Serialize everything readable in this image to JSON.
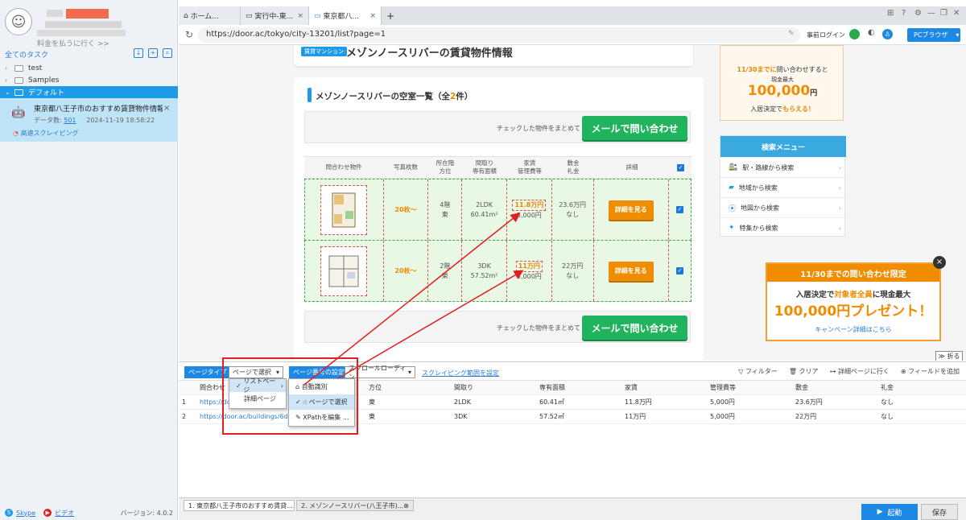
{
  "sidebar": {
    "pay_link": "料金を払うに行く >>",
    "all_tasks": "全てのタスク",
    "tree": [
      {
        "label": "test"
      },
      {
        "label": "Samples"
      },
      {
        "label": "デフォルト"
      }
    ],
    "task": {
      "title": "東京都八王子市のおすすめ賃貸物件情報【...",
      "data_label": "データ数:",
      "data_count": "501",
      "date": "2024-11-19 18:58:22",
      "speed": "高速スクレイピング"
    },
    "footer": {
      "skype": "Skype",
      "video": "ビデオ",
      "version": "バージョン: 4.0.2"
    }
  },
  "browser": {
    "tabs": [
      "ホーム...",
      "実行中-東...",
      "東京都八..."
    ],
    "new_tab": "+",
    "url": "https://door.ac/tokyo/city-13201/list?page=1",
    "login": "事前ログイン",
    "pc_browser": "PCブラウザ"
  },
  "page": {
    "badge": "賃貸マンション",
    "title": "メゾンノースリバーの賃貸物件情報",
    "section_title_prefix": "メゾンノースリバーの空室一覧（全",
    "section_count": "2",
    "section_title_suffix": "件）",
    "mail_note": "チェックした物件をまとめて",
    "mail_button": "メールで問い合わせ",
    "headers": [
      "問合わせ物件",
      "写真枚数",
      "所在階\n方位",
      "間取り\n専有面積",
      "家賃\n管理費等",
      "敷金\n礼金",
      "詳細"
    ],
    "rows": [
      {
        "photos": "20枚～",
        "floor": "4階",
        "dir": "東",
        "layout": "2LDK",
        "area": "60.41m²",
        "rent": "11.8万円",
        "fee": "5,000円",
        "deposit": "23.6万円",
        "key": "なし",
        "detail": "詳細を見る"
      },
      {
        "photos": "20枚～",
        "floor": "2階",
        "dir": "東",
        "layout": "3DK",
        "area": "57.52m²",
        "rent": "11万円",
        "fee": "5,000円",
        "deposit": "22万円",
        "key": "なし",
        "detail": "詳細を見る"
      }
    ],
    "promo_top": {
      "l1a": "11/30までに",
      "l1b": "問い合わせすると",
      "l2": "現金最大",
      "l3": "100,000",
      "l3u": "円",
      "l4a": "入居決定で",
      "l4b": "もらえる！"
    },
    "search_menu": {
      "title": "検索メニュー",
      "items": [
        "駅・路線から検索",
        "地域から検索",
        "地図から検索",
        "特集から検索"
      ]
    },
    "promo": {
      "head": "11/30までの問い合わせ限定",
      "a1": "入居決定で",
      "a2": "対象者全員",
      "a3": "に現金最大",
      "b": "100,000円プレゼント！",
      "c": "キャンペーン詳細はこちら"
    },
    "fold": "折る"
  },
  "panel": {
    "page_type": "ページタイプ",
    "select_value": "ページで選択",
    "page_setting": "ページ番号の設定",
    "scroll": "スクロールローディン",
    "scrape_range": "スクレイピング範囲を設定",
    "tools": [
      "フィルター",
      "クリア",
      "詳細ページに行く",
      "フィールドを追加"
    ],
    "dropdown1": [
      "リストページ",
      "詳細ページ"
    ],
    "dropdown2": [
      "自動識別",
      "ページで選択",
      "XPathを編集 ..."
    ],
    "columns": [
      "",
      "問合わせ",
      "",
      "方位",
      "間取り",
      "専有面積",
      "家賃",
      "管理費等",
      "敷金",
      "礼金"
    ],
    "rows": [
      [
        "1",
        "https://door",
        "",
        "東",
        "2LDK",
        "60.41㎡",
        "11.8万円",
        "5,000円",
        "23.6万円",
        "なし"
      ],
      [
        "2",
        "https://door.ac/buildings/6d...",
        "",
        "東",
        "3DK",
        "57.52㎡",
        "11万円",
        "5,000円",
        "22万円",
        "なし"
      ]
    ]
  },
  "taskbar": {
    "tabs": [
      "1. 東京都八王子市のおすすめ賃貸...",
      "2. メゾンノースリバー(八王子市)..."
    ],
    "start": "起動",
    "save": "保存"
  }
}
